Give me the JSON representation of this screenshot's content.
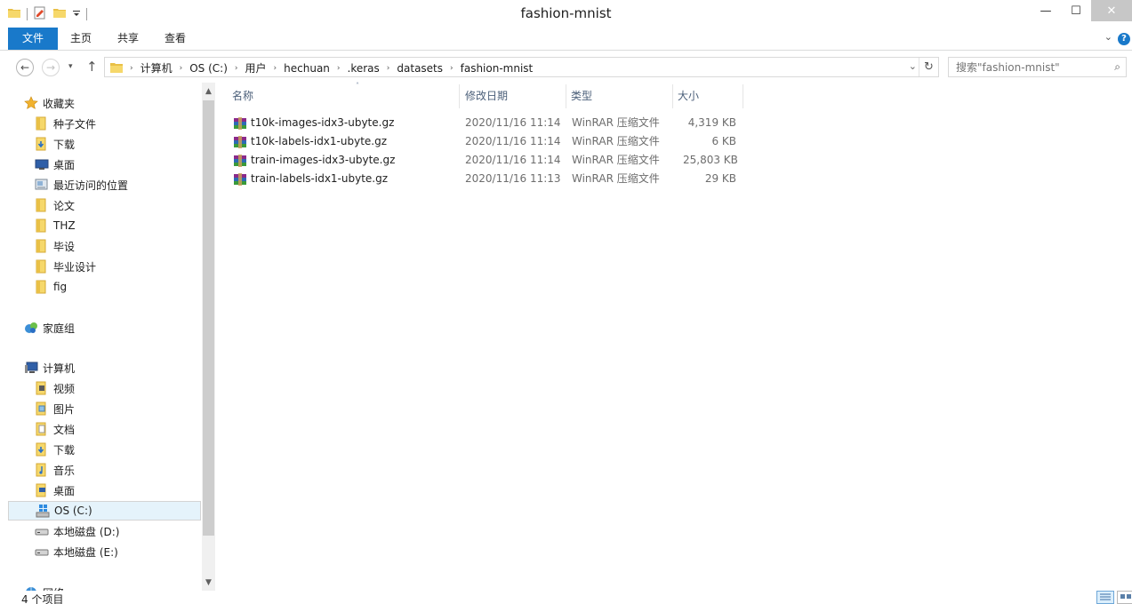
{
  "window": {
    "title": "fashion-mnist",
    "minimize_glyph": "—",
    "maximize_glyph": "☐",
    "close_glyph": "✕"
  },
  "ribbon": {
    "tabs": [
      "文件",
      "主页",
      "共享",
      "查看"
    ],
    "help_glyph": "?",
    "expand_glyph": "⌄"
  },
  "nav": {
    "back_glyph": "←",
    "forward_glyph": "→",
    "recent_glyph": "▾",
    "up_glyph": "↑",
    "breadcrumb": [
      "计算机",
      "OS (C:)",
      "用户",
      "hechuan",
      ".keras",
      "datasets",
      "fashion-mnist"
    ],
    "crumb_separator": "›",
    "dropdown_glyph": "⌄",
    "refresh_glyph": "↻",
    "search_placeholder": "搜索\"fashion-mnist\"",
    "search_glyph": "⌕"
  },
  "sidebar": {
    "favorites": {
      "label": "收藏夹",
      "items": [
        {
          "label": "种子文件",
          "icon": "folder-icon"
        },
        {
          "label": "下载",
          "icon": "downloads-folder-icon"
        },
        {
          "label": "桌面",
          "icon": "desktop-icon"
        },
        {
          "label": "最近访问的位置",
          "icon": "recent-places-icon"
        },
        {
          "label": "论文",
          "icon": "folder-icon"
        },
        {
          "label": "THZ",
          "icon": "folder-icon"
        },
        {
          "label": "毕设",
          "icon": "folder-icon"
        },
        {
          "label": "毕业设计",
          "icon": "folder-icon"
        },
        {
          "label": "fig",
          "icon": "folder-icon"
        }
      ]
    },
    "homegroup": {
      "label": "家庭组"
    },
    "computer": {
      "label": "计算机",
      "items": [
        {
          "label": "视频",
          "icon": "videos-folder-icon"
        },
        {
          "label": "图片",
          "icon": "pictures-folder-icon"
        },
        {
          "label": "文档",
          "icon": "documents-folder-icon"
        },
        {
          "label": "下载",
          "icon": "downloads-folder-icon"
        },
        {
          "label": "音乐",
          "icon": "music-folder-icon"
        },
        {
          "label": "桌面",
          "icon": "desktop-folder-icon"
        },
        {
          "label": "OS (C:)",
          "icon": "windows-drive-icon",
          "selected": true
        },
        {
          "label": "本地磁盘 (D:)",
          "icon": "hard-drive-icon"
        },
        {
          "label": "本地磁盘 (E:)",
          "icon": "hard-drive-icon"
        }
      ]
    },
    "network": {
      "label": "网络"
    },
    "scroll_up_glyph": "▲",
    "scroll_down_glyph": "▼"
  },
  "file_list": {
    "columns": [
      "名称",
      "修改日期",
      "类型",
      "大小"
    ],
    "sort_glyph": "˄",
    "rows": [
      {
        "name": "t10k-images-idx3-ubyte.gz",
        "date": "2020/11/16 11:14",
        "type": "WinRAR 压缩文件",
        "size": "4,319 KB"
      },
      {
        "name": "t10k-labels-idx1-ubyte.gz",
        "date": "2020/11/16 11:14",
        "type": "WinRAR 压缩文件",
        "size": "6 KB"
      },
      {
        "name": "train-images-idx3-ubyte.gz",
        "date": "2020/11/16 11:14",
        "type": "WinRAR 压缩文件",
        "size": "25,803 KB"
      },
      {
        "name": "train-labels-idx1-ubyte.gz",
        "date": "2020/11/16 11:13",
        "type": "WinRAR 压缩文件",
        "size": "29 KB"
      }
    ]
  },
  "status": {
    "item_count": "4 个项目"
  },
  "colors": {
    "accent": "#1979ca",
    "selection": "#e5f3fb",
    "header_text": "#4c607a"
  }
}
